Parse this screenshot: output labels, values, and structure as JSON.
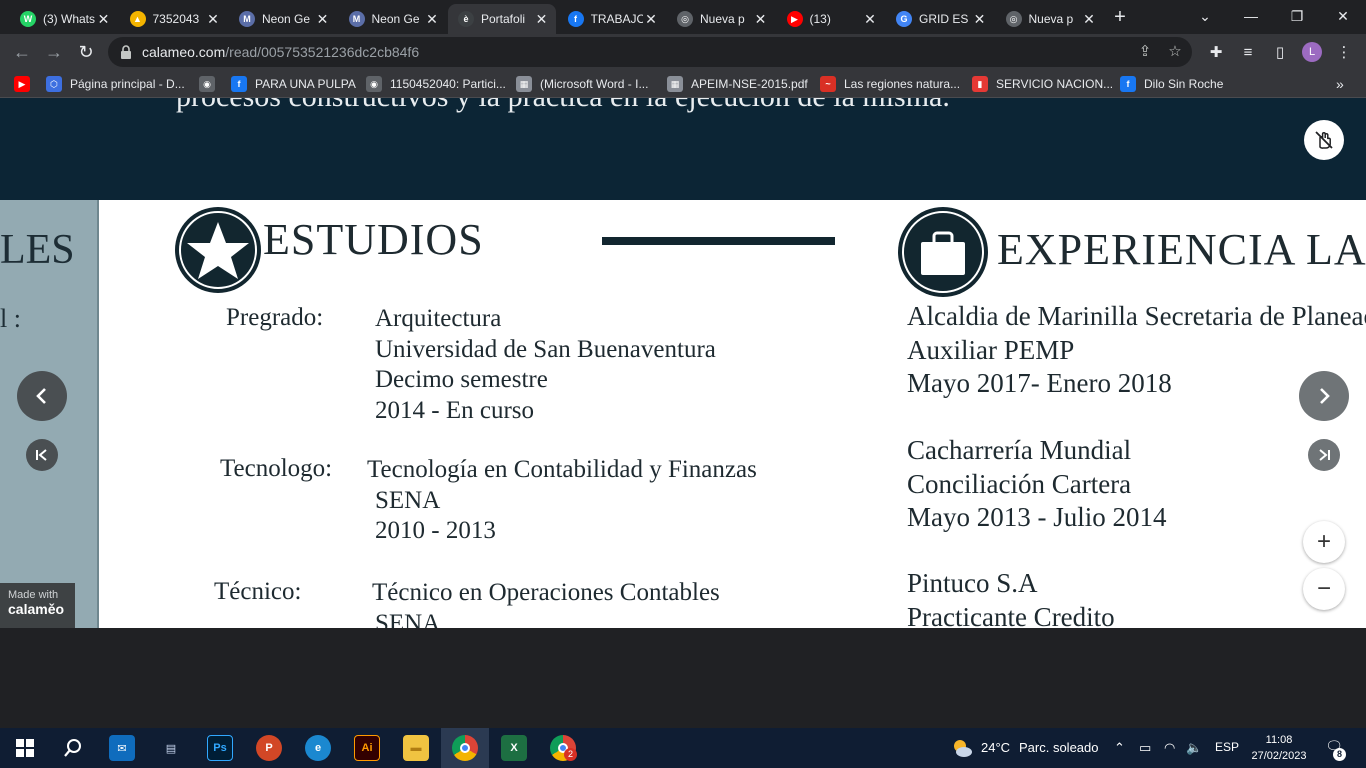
{
  "browser": {
    "tabs": [
      {
        "title": "(3) Whats",
        "icon": "whatsapp-icon",
        "color": "#25d366",
        "glyph": "W"
      },
      {
        "title": "7352043",
        "icon": "google-drive-icon",
        "color": "#f4b400",
        "glyph": "▲"
      },
      {
        "title": "Neon Ge",
        "icon": "neon-genesis-icon",
        "color": "#5b6ea8",
        "glyph": "M"
      },
      {
        "title": "Neon Ge",
        "icon": "neon-genesis-icon",
        "color": "#5b6ea8",
        "glyph": "M"
      },
      {
        "title": "Portafoli",
        "icon": "edge-document-icon",
        "color": "#3c4043",
        "glyph": "è"
      },
      {
        "title": "TRABAJO",
        "icon": "facebook-icon",
        "color": "#1877f2",
        "glyph": "f"
      },
      {
        "title": "Nueva p",
        "icon": "chrome-icon",
        "color": "#5f6368",
        "glyph": "◎"
      },
      {
        "title": "(13)",
        "icon": "youtube-icon",
        "color": "#ff0000",
        "glyph": "▶"
      },
      {
        "title": "GRID ES",
        "icon": "google-icon",
        "color": "#4285f4",
        "glyph": "G"
      },
      {
        "title": "Nueva p",
        "icon": "chrome-icon",
        "color": "#5f6368",
        "glyph": "◎"
      }
    ],
    "active_tab_index": 4,
    "url_host": "calameo.com",
    "url_path": "/read/005753521236dc2cb84f6",
    "profile_initial": "L",
    "bookmarks": [
      {
        "label": "",
        "icon": "youtube-icon",
        "color": "#ff0000",
        "glyph": "▶"
      },
      {
        "label": "Página principal - D...",
        "icon": "dropbox-icon",
        "color": "#3d6fe0",
        "glyph": "⬡"
      },
      {
        "label": "",
        "icon": "globe-icon",
        "color": "#5f6368",
        "glyph": "◉"
      },
      {
        "label": "PARA UNA PULPA",
        "icon": "facebook-icon",
        "color": "#1877f2",
        "glyph": "f"
      },
      {
        "label": "1150452040: Partici...",
        "icon": "globe-icon",
        "color": "#5f6368",
        "glyph": "◉"
      },
      {
        "label": "(Microsoft Word - I...",
        "icon": "document-icon",
        "color": "#8a8f98",
        "glyph": "▦"
      },
      {
        "label": "APEIM-NSE-2015.pdf",
        "icon": "document-icon",
        "color": "#8a8f98",
        "glyph": "▦"
      },
      {
        "label": "Las regiones natura...",
        "icon": "tilde-icon",
        "color": "#d93025",
        "glyph": "~"
      },
      {
        "label": "SERVICIO NACION...",
        "icon": "flag-icon",
        "color": "#e53935",
        "glyph": "▮"
      },
      {
        "label": "Dilo Sin Roche",
        "icon": "facebook-icon",
        "color": "#1877f2",
        "glyph": "f"
      }
    ]
  },
  "document": {
    "top_cut_text": "procesos constructivos y la práctica en la ejecución de la misma.",
    "left_page": {
      "heading_fragment": "LES",
      "text_fragment": "l :"
    },
    "estudios": {
      "title": "ESTUDIOS",
      "entries": [
        {
          "label": "Pregrado:",
          "lines": [
            "Arquitectura",
            "Universidad de San Buenaventura",
            "Decimo semestre",
            "2014 - En curso"
          ]
        },
        {
          "label": "Tecnologo:",
          "lines": [
            "Tecnología en Contabilidad y Finanzas",
            "SENA",
            "2010 - 2013"
          ]
        },
        {
          "label": "Técnico:",
          "lines": [
            "Técnico en Operaciones Contables",
            "SENA"
          ]
        }
      ]
    },
    "experiencia": {
      "title": "EXPERIENCIA LABORAL",
      "entries": [
        [
          "Alcaldia de Marinilla Secretaria de Planeación",
          "Auxiliar PEMP",
          "Mayo 2017- Enero 2018"
        ],
        [
          "Cacharrería Mundial",
          "Conciliación Cartera",
          "Mayo 2013 - Julio 2014"
        ],
        [
          "Pintuco S.A",
          "Practicante Credito"
        ]
      ]
    }
  },
  "viewer": {
    "badge_line1": "Made with",
    "badge_line2": "calaměo",
    "zoom_in": "+",
    "zoom_out": "−"
  },
  "taskbar": {
    "temperature": "24°C",
    "weather": "Parc. soleado",
    "language": "ESP",
    "time": "11:08",
    "date": "27/02/2023",
    "notifications": "8",
    "chrome_badge": "2"
  }
}
